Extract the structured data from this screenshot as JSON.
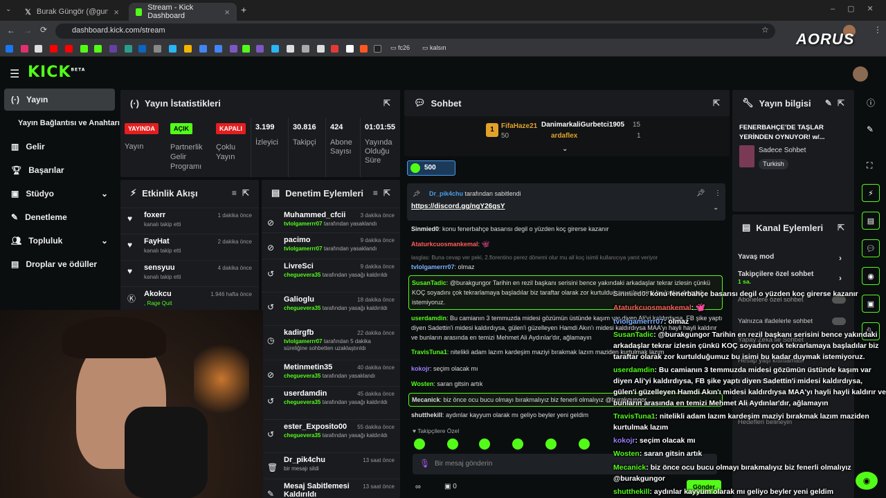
{
  "browser": {
    "tabs": [
      {
        "label": "Burak Güngör (@gungorburak)"
      },
      {
        "label": "Stream - Kick Dashboard"
      }
    ],
    "url": "dashboard.kick.com/stream",
    "bookmarks": {
      "folder1": "fc26",
      "folder2": "kalsın"
    },
    "brand": "AORUS"
  },
  "kick": {
    "logo": "KICK",
    "beta": "BETA"
  },
  "sidebar": {
    "items": [
      {
        "label": "Yayın"
      },
      {
        "label": "Yayın Bağlantısı ve Anahtarı"
      },
      {
        "label": "Gelir"
      },
      {
        "label": "Başarılar"
      },
      {
        "label": "Stüdyo"
      },
      {
        "label": "Denetleme"
      },
      {
        "label": "Topluluk"
      },
      {
        "label": "Droplar ve ödüller"
      }
    ]
  },
  "stats": {
    "title": "Yayın İstatistikleri",
    "items": [
      {
        "badge": "YAYINDA",
        "label": "Yayın"
      },
      {
        "badge": "AÇIK",
        "label": "Partnerlik Gelir Programı"
      },
      {
        "badge": "KAPALI",
        "label": "Çoklu Yayın"
      },
      {
        "value": "3.199",
        "label": "İzleyici"
      },
      {
        "value": "30.816",
        "label": "Takipçi"
      },
      {
        "value": "424",
        "label": "Abone Sayısı"
      },
      {
        "value": "01:01:55",
        "label": "Yayında Olduğu Süre"
      }
    ]
  },
  "activity": {
    "title": "Etkinlik Akışı",
    "items": [
      {
        "name": "foxerr",
        "sub": "kanalı takip etti",
        "time": "1 dakika önce"
      },
      {
        "name": "FayHat",
        "sub": "kanalı takip etti",
        "time": "2 dakika önce"
      },
      {
        "name": "sensyuu",
        "sub": "kanalı takip etti",
        "time": "4 dakika önce"
      },
      {
        "name": "Akokcu",
        "sub": ", Rage Quit",
        "time": "1.946 hafta önce"
      }
    ]
  },
  "moderation": {
    "title": "Denetim Eylemleri",
    "items": [
      {
        "name": "Muhammed_cfcii",
        "actor": "tvlolgamerrr07",
        "sub": " tarafından yasaklandı",
        "time": "3 dakika önce"
      },
      {
        "name": "pacimo",
        "actor": "tvlolgamerrr07",
        "sub": " tarafından yasaklandı",
        "time": "9 dakika önce"
      },
      {
        "name": "LivreSci",
        "actor": "cheguevera35",
        "sub": " tarafından yasağı kaldırıldı",
        "time": "9 dakika önce"
      },
      {
        "name": "Galioglu",
        "actor": "cheguevera35",
        "sub": " tarafından yasağı kaldırıldı",
        "time": "18 dakika önce"
      },
      {
        "name": "kadirgfb",
        "actor": "tvlolgamerrr07",
        "sub": " tarafından 5 dakika süreliğine sohbetten uzaklaştırıldı",
        "time": "22 dakika önce"
      },
      {
        "name": "Metinmetin35",
        "actor": "cheguevera35",
        "sub": " tarafından yasaklandı",
        "time": "40 dakika önce"
      },
      {
        "name": "userdamdin",
        "actor": "cheguevera35",
        "sub": " tarafından yasağı kaldırıldı",
        "time": "45 dakika önce"
      },
      {
        "name": "ester_Exposito00",
        "actor": "cheguevera35",
        "sub": " tarafından yasağı kaldırıldı",
        "time": "55 dakika önce"
      },
      {
        "name": "Dr_pik4chu",
        "actor": "",
        "sub": "bir mesajı sildi",
        "time": "13 saat önce"
      },
      {
        "name": "Mesaj Sabitlemesi Kaldırıldı",
        "actor": "",
        "sub": "",
        "time": "13 saat önce"
      }
    ]
  },
  "chat": {
    "title": "Sohbet",
    "leaders": {
      "first": "FifaHaze21",
      "first_amt": "50",
      "second": "DanimarkaliGurbetci1905",
      "second_amt": "15",
      "third": "ardaflex",
      "third_amt": "1"
    },
    "goal": "500",
    "pinned": {
      "by": "Dr_pik4chu",
      "suffix": " tarafından sabitlendi",
      "link": "https://discord.gg/ngY26gsY"
    },
    "messages": [
      {
        "user": "Sinmied0",
        "text": ": konu fenerbahçe basarısı degil o yüzden koç girerse kazanır"
      },
      {
        "user": "Ataturkcuosmankemal",
        "text": ":"
      },
      {
        "user": "",
        "text": "lasglas: Buna cevap ver peki, 2.florentino perez dönemi olur mu all koç isimli kullanıcıya yanıt veriyor"
      },
      {
        "user": "tvlolgamerrr07",
        "text": ": olmaz"
      },
      {
        "user": "SusanTadic",
        "text": ": @burakgungor Tarihin en rezil başkanı serisini bence yakındaki arkadaşlar tekrar izlesin çünkü KOÇ soyadını çok tekrarlamaya başladılar biz taraftar olarak zor kurtulduğumuz bu isimi bu kadar duymak istemiyoruz."
      },
      {
        "user": "userdamdin",
        "text": ": Bu camianın 3 temmuzda midesi gözümün üstünde kaşım var diyen Ali'yi kaldırdıysa, FB şike yaptı diyen Sadettin'i midesi kaldırdıysa, gülen'i güzelleyen Hamdi Akın'ı midesi kaldırdıysa MAA'yı hayli hayli kaldırır ve bunların arasında en temizi Mehmet Ali Aydınlar'dır, ağlamayın"
      },
      {
        "user": "TravisTuna1",
        "text": ": nitelikli adam lazım kardeşim maziyi bırakmak lazım maziden kurtulmak lazım"
      },
      {
        "user": "kokojr",
        "text": ": seçim olacak mı"
      },
      {
        "user": "Wosten",
        "text": ": saran gitsin artık"
      },
      {
        "user": "Mecanick",
        "text": ": biz önce ocu bucu olmayı bırakmalıyız biz fenerli olmalıyız @burakgungor"
      },
      {
        "user": "shutthekill",
        "text": ": aydınlar kayyum olarak mı geliyo beyler yeni geldim"
      }
    ],
    "followers_only": "Takipçilere Özel",
    "placeholder": "Bir mesaj gönderin",
    "send": "Gönder",
    "count": "0"
  },
  "info": {
    "title": "Yayın bilgisi",
    "stream_title": "FENERBAHÇE'DE TAŞLAR YERİNDEN OYNUYOR! w/...",
    "category": "Sadece Sohbet",
    "tag": "Turkish"
  },
  "actions": {
    "title": "Kanal Eylemleri",
    "items": [
      {
        "label": "Yavaş mod"
      },
      {
        "label": "Takipçilere özel sohbet",
        "sub": "1 sa."
      },
      {
        "label": "Abonelere özel sohbet"
      },
      {
        "label": "Yalnızca ifadelerle sohbet"
      },
      {
        "label": "Yapay Zeka ile Sohbet"
      },
      {
        "label": "Hesap yaşı kısıtlaması"
      },
      {
        "label": "Yasaklanmış kelimeler"
      },
      {
        "label": "Heyici Yönlendir"
      },
      {
        "label": "Hedefleri belirleyin"
      }
    ]
  },
  "overlay": {
    "messages": [
      {
        "user": "Sinmied0",
        "text": ": konu fenerbahçe basarısı degil o yüzden koç girerse kazanır"
      },
      {
        "user": "Ataturkcuosmankemal",
        "text": ":"
      },
      {
        "user": "tvlolgamerrr07",
        "text": ": olmaz"
      },
      {
        "user": "SusanTadic",
        "text": ": @burakgungor Tarihin en rezil başkanı serisini bence yakındaki arkadaşlar tekrar izlesin çünkü KOÇ soyadını çok tekrarlamaya başladılar biz taraftar olarak zor kurtulduğumuz bu isimi bu kadar duymak istemiyoruz."
      },
      {
        "user": "userdamdin",
        "text": ": Bu camianın 3 temmuzda midesi gözümün üstünde kaşım var diyen Ali'yi kaldırdıysa, FB şike yaptı diyen Sadettin'i midesi kaldırdıysa, gülen'i güzelleyen Hamdi Akın'ı midesi kaldırdıysa MAA'yı hayli hayli kaldırır ve bunların arasında en temizi Mehmet Ali Aydınlar'dır, ağlamayın"
      },
      {
        "user": "TravisTuna1",
        "text": ": nitelikli adam lazım kardeşim maziyi bırakmak lazım maziden kurtulmak lazım"
      },
      {
        "user": "kokojr",
        "text": ": seçim olacak mı"
      },
      {
        "user": "Wosten",
        "text": ": saran gitsin artık"
      },
      {
        "user": "Mecanick",
        "text": ": biz önce ocu bucu olmayı bırakmalıyız biz fenerli olmalıyız @burakgungor"
      },
      {
        "user": "shutthekill",
        "text": ": aydınlar kayyum olarak mı geliyo beyler yeni geldim"
      }
    ]
  },
  "colors": {
    "accent": "#53fc18",
    "live": "#e41e1e",
    "panel": "#191b1f",
    "bg": "#0b0e0f"
  }
}
